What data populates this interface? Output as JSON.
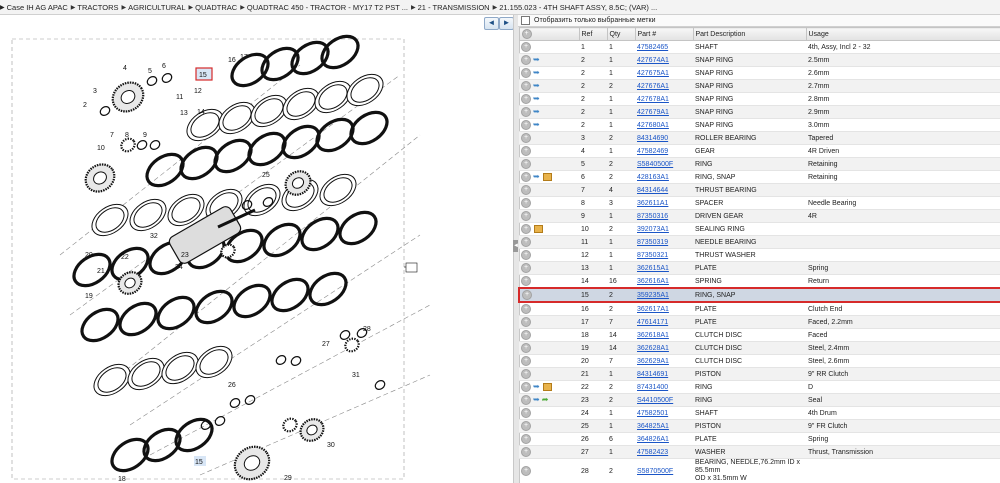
{
  "breadcrumb": [
    "Case IH AG APAC",
    "TRACTORS",
    "AGRICULTURAL",
    "QUADTRAC",
    "QUADTRAC 450 - TRACTOR - MY17 T2 PST ...",
    "21 - TRANSMISSION",
    "21.155.023 - 4TH SHAFT ASSY, 8.5C; (VAR) ..."
  ],
  "toolbar": {
    "back_icon": "arrow-left-icon",
    "forward_icon": "arrow-right-icon",
    "back_label": "◄",
    "forward_label": "►"
  },
  "diagram": {
    "callouts": [
      "1",
      "2",
      "3",
      "4",
      "5",
      "6",
      "7",
      "8",
      "9",
      "10",
      "11",
      "12",
      "13",
      "14",
      "15",
      "16",
      "17",
      "18",
      "19",
      "20",
      "21",
      "22",
      "23",
      "24",
      "25",
      "26",
      "27",
      "28",
      "29",
      "30",
      "31",
      "32"
    ],
    "sheet_label": "1",
    "selected_callout": "15"
  },
  "filter": {
    "label": "Отобразить только выбранные метки",
    "checked": false
  },
  "table": {
    "columns": [
      "",
      "Ref",
      "Qty",
      "Part #",
      "Part Description",
      "Usage"
    ],
    "rows": [
      {
        "ref": "1",
        "qty": "1",
        "part": "47582465",
        "desc": "SHAFT",
        "usage": "4th, Assy, Incl 2 - 32",
        "icons": []
      },
      {
        "ref": "2",
        "qty": "1",
        "part": "427674A1",
        "desc": "SNAP RING",
        "usage": "2.5mm",
        "icons": [
          "swap"
        ]
      },
      {
        "ref": "2",
        "qty": "1",
        "part": "427675A1",
        "desc": "SNAP RING",
        "usage": "2.6mm",
        "icons": [
          "swap"
        ]
      },
      {
        "ref": "2",
        "qty": "2",
        "part": "427676A1",
        "desc": "SNAP RING",
        "usage": "2.7mm",
        "icons": [
          "swap"
        ]
      },
      {
        "ref": "2",
        "qty": "1",
        "part": "427678A1",
        "desc": "SNAP RING",
        "usage": "2.8mm",
        "icons": [
          "swap"
        ]
      },
      {
        "ref": "2",
        "qty": "1",
        "part": "427679A1",
        "desc": "SNAP RING",
        "usage": "2.9mm",
        "icons": [
          "swap"
        ]
      },
      {
        "ref": "2",
        "qty": "1",
        "part": "427680A1",
        "desc": "SNAP RING",
        "usage": "3.0mm",
        "icons": [
          "swap"
        ]
      },
      {
        "ref": "3",
        "qty": "2",
        "part": "84314690",
        "desc": "ROLLER BEARING",
        "usage": "Tapered",
        "icons": []
      },
      {
        "ref": "4",
        "qty": "1",
        "part": "47582469",
        "desc": "GEAR",
        "usage": "4R Driven",
        "icons": []
      },
      {
        "ref": "5",
        "qty": "2",
        "part": "S5840500F",
        "desc": "RING",
        "usage": "Retaining",
        "icons": []
      },
      {
        "ref": "6",
        "qty": "2",
        "part": "428163A1",
        "desc": "RING, SNAP",
        "usage": "Retaining",
        "icons": [
          "swap",
          "box"
        ]
      },
      {
        "ref": "7",
        "qty": "4",
        "part": "84314644",
        "desc": "THRUST BEARING",
        "usage": "",
        "icons": []
      },
      {
        "ref": "8",
        "qty": "3",
        "part": "362611A1",
        "desc": "SPACER",
        "usage": "Needle Bearing",
        "icons": []
      },
      {
        "ref": "9",
        "qty": "1",
        "part": "87350316",
        "desc": "DRIVEN GEAR",
        "usage": "4R",
        "icons": []
      },
      {
        "ref": "10",
        "qty": "2",
        "part": "392073A1",
        "desc": "SEALING RING",
        "usage": "",
        "icons": [
          "box"
        ]
      },
      {
        "ref": "11",
        "qty": "1",
        "part": "87350319",
        "desc": "NEEDLE BEARING",
        "usage": "",
        "icons": []
      },
      {
        "ref": "12",
        "qty": "1",
        "part": "87350321",
        "desc": "THRUST WASHER",
        "usage": "",
        "icons": []
      },
      {
        "ref": "13",
        "qty": "1",
        "part": "362615A1",
        "desc": "PLATE",
        "usage": "Spring",
        "icons": []
      },
      {
        "ref": "14",
        "qty": "16",
        "part": "362616A1",
        "desc": "SPRING",
        "usage": "Return",
        "icons": []
      },
      {
        "ref": "15",
        "qty": "2",
        "part": "359235A1",
        "desc": "RING, SNAP",
        "usage": "",
        "icons": [],
        "selected": true
      },
      {
        "ref": "16",
        "qty": "2",
        "part": "362617A1",
        "desc": "PLATE",
        "usage": "Clutch End",
        "icons": []
      },
      {
        "ref": "17",
        "qty": "7",
        "part": "47614171",
        "desc": "PLATE",
        "usage": "Faced, 2.2mm",
        "icons": []
      },
      {
        "ref": "18",
        "qty": "14",
        "part": "362618A1",
        "desc": "CLUTCH DISC",
        "usage": "Faced",
        "icons": []
      },
      {
        "ref": "19",
        "qty": "14",
        "part": "362628A1",
        "desc": "CLUTCH DISC",
        "usage": "Steel, 2.4mm",
        "icons": []
      },
      {
        "ref": "20",
        "qty": "7",
        "part": "362629A1",
        "desc": "CLUTCH DISC",
        "usage": "Steel, 2.6mm",
        "icons": []
      },
      {
        "ref": "21",
        "qty": "1",
        "part": "84314691",
        "desc": "PISTON",
        "usage": "9\" RR Clutch",
        "icons": []
      },
      {
        "ref": "22",
        "qty": "2",
        "part": "87431400",
        "desc": "RING",
        "usage": "D",
        "icons": [
          "swap",
          "box"
        ]
      },
      {
        "ref": "23",
        "qty": "2",
        "part": "S4410500F",
        "desc": "RING",
        "usage": "Seal",
        "icons": [
          "swap",
          "green"
        ]
      },
      {
        "ref": "24",
        "qty": "1",
        "part": "47582501",
        "desc": "SHAFT",
        "usage": "4th Drum",
        "icons": []
      },
      {
        "ref": "25",
        "qty": "1",
        "part": "364825A1",
        "desc": "PISTON",
        "usage": "9\" FR Clutch",
        "icons": []
      },
      {
        "ref": "26",
        "qty": "6",
        "part": "364826A1",
        "desc": "PLATE",
        "usage": "Spring",
        "icons": []
      },
      {
        "ref": "27",
        "qty": "1",
        "part": "47582423",
        "desc": "WASHER",
        "usage": "Thrust, Transmission",
        "icons": []
      },
      {
        "ref": "28",
        "qty": "2",
        "part": "S5870500F",
        "desc": "BEARING, NEEDLE,76.2mm ID x 85.5mm",
        "desc2": "OD x 31.5mm W",
        "usage": "",
        "icons": []
      }
    ]
  },
  "colors": {
    "link": "#1a55c7",
    "selection_border": "#d62a2a",
    "selected_row": "#cfd7e3"
  }
}
